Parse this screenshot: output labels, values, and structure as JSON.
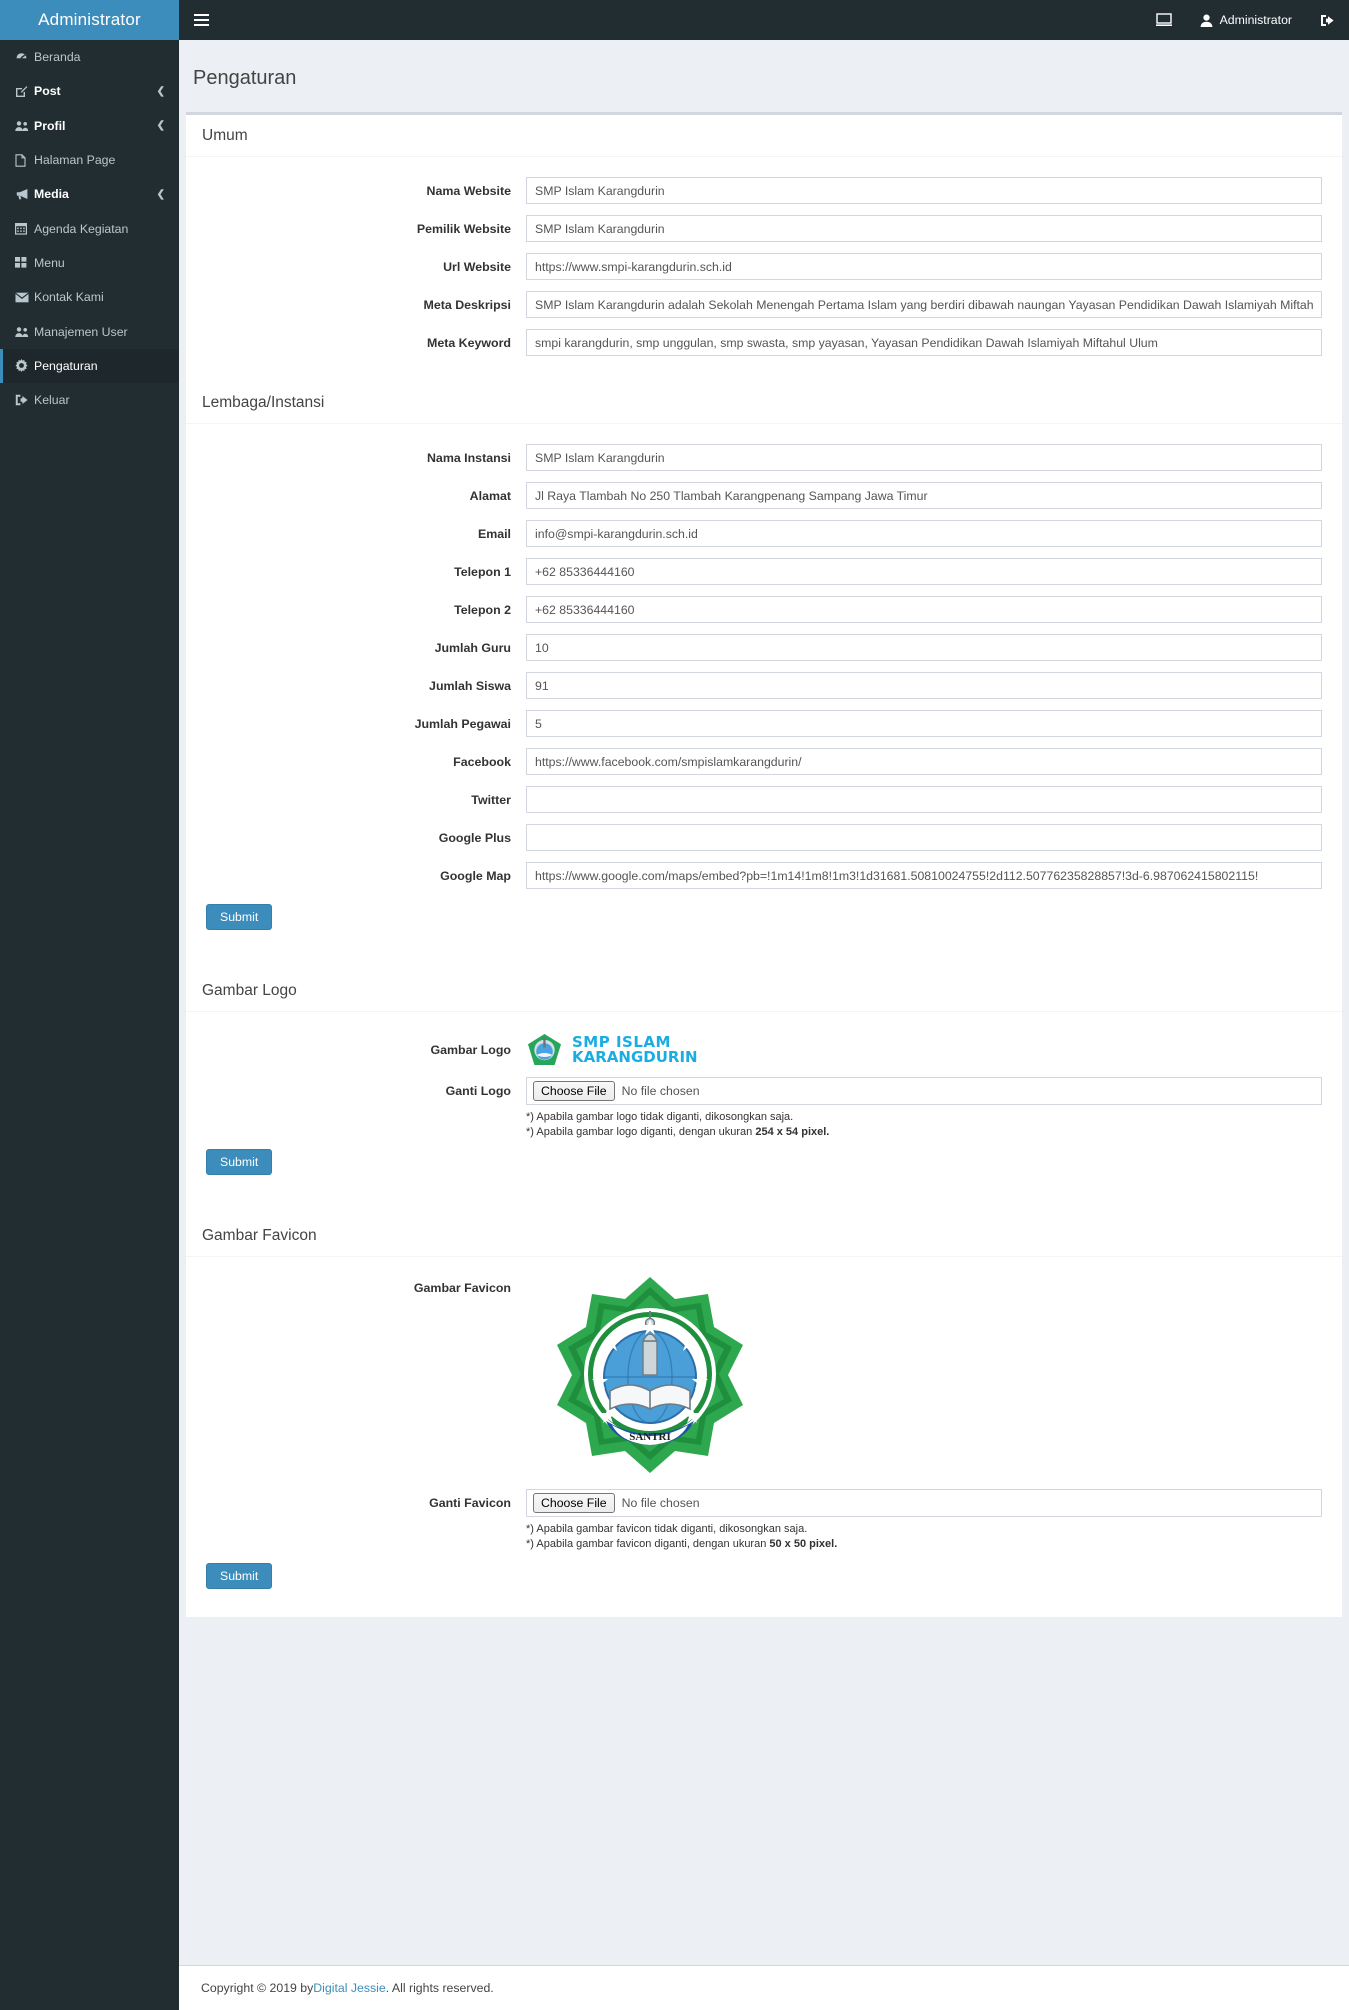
{
  "brand": {
    "title": "Administrator"
  },
  "topbar": {
    "hamburger_icon": "hamburger-icon",
    "screen_icon": "monitor-icon",
    "user_label": "Administrator",
    "logout_icon": "sign-out-icon"
  },
  "sidebar": {
    "items": [
      {
        "label": "Beranda",
        "icon": "dashboard-icon",
        "arrow": false,
        "strong": false,
        "active": false
      },
      {
        "label": "Post",
        "icon": "edit-icon",
        "arrow": true,
        "strong": true,
        "active": false
      },
      {
        "label": "Profil",
        "icon": "users-icon",
        "arrow": true,
        "strong": true,
        "active": false
      },
      {
        "label": "Halaman Page",
        "icon": "file-icon",
        "arrow": false,
        "strong": false,
        "active": false
      },
      {
        "label": "Media",
        "icon": "bullhorn-icon",
        "arrow": true,
        "strong": true,
        "active": false
      },
      {
        "label": "Agenda Kegiatan",
        "icon": "calendar-icon",
        "arrow": false,
        "strong": false,
        "active": false
      },
      {
        "label": "Menu",
        "icon": "grid-icon",
        "arrow": false,
        "strong": false,
        "active": false
      },
      {
        "label": "Kontak Kami",
        "icon": "envelope-icon",
        "arrow": false,
        "strong": false,
        "active": false
      },
      {
        "label": "Manajemen User",
        "icon": "users-icon",
        "arrow": false,
        "strong": false,
        "active": false
      },
      {
        "label": "Pengaturan",
        "icon": "gear-icon",
        "arrow": false,
        "strong": false,
        "active": true
      },
      {
        "label": "Keluar",
        "icon": "sign-out-icon",
        "arrow": false,
        "strong": false,
        "active": false
      }
    ]
  },
  "page": {
    "title": "Pengaturan"
  },
  "sections": {
    "umum": {
      "heading": "Umum",
      "fields": [
        {
          "label": "Nama Website",
          "value": "SMP Islam Karangdurin"
        },
        {
          "label": "Pemilik Website",
          "value": "SMP Islam Karangdurin"
        },
        {
          "label": "Url Website",
          "value": "https://www.smpi-karangdurin.sch.id"
        },
        {
          "label": "Meta Deskripsi",
          "value": "SMP Islam Karangdurin adalah Sekolah Menengah Pertama Islam yang berdiri dibawah naungan Yayasan Pendidikan Dawah Islamiyah Miftahul Ulum"
        },
        {
          "label": "Meta Keyword",
          "value": "smpi karangdurin, smp unggulan, smp swasta, smp yayasan, Yayasan Pendidikan Dawah Islamiyah Miftahul Ulum"
        }
      ]
    },
    "lembaga": {
      "heading": "Lembaga/Instansi",
      "fields": [
        {
          "label": "Nama Instansi",
          "value": "SMP Islam Karangdurin"
        },
        {
          "label": "Alamat",
          "value": "Jl Raya Tlambah No 250 Tlambah Karangpenang Sampang Jawa Timur"
        },
        {
          "label": "Email",
          "value": "info@smpi-karangdurin.sch.id"
        },
        {
          "label": "Telepon 1",
          "value": "+62 85336444160"
        },
        {
          "label": "Telepon 2",
          "value": "+62 85336444160"
        },
        {
          "label": "Jumlah Guru",
          "value": "10"
        },
        {
          "label": "Jumlah Siswa",
          "value": "91"
        },
        {
          "label": "Jumlah Pegawai",
          "value": "5"
        },
        {
          "label": "Facebook",
          "value": "https://www.facebook.com/smpislamkarangdurin/"
        },
        {
          "label": "Twitter",
          "value": ""
        },
        {
          "label": "Google Plus",
          "value": ""
        },
        {
          "label": "Google Map",
          "value": "https://www.google.com/maps/embed?pb=!1m14!1m8!1m3!1d31681.50810024755!2d112.50776235828857!3d-6.987062415802115!"
        }
      ],
      "submit_label": "Submit"
    },
    "logo": {
      "heading": "Gambar Logo",
      "image_label": "Gambar Logo",
      "logo_text_line1": "SMP  ISLAM",
      "logo_text_line2": "KARANGDURIN",
      "change_label": "Ganti Logo",
      "file_button": "Choose File",
      "file_status": "No file chosen",
      "hint1_a": "*) Apabila gambar logo tidak diganti, dikosongkan saja.",
      "hint2_a": "*) Apabila gambar logo diganti, dengan ukuran ",
      "hint2_b": "254 x 54 pixel.",
      "submit_label": "Submit"
    },
    "favicon": {
      "heading": "Gambar Favicon",
      "image_label": "Gambar Favicon",
      "change_label": "Ganti Favicon",
      "file_button": "Choose File",
      "file_status": "No file chosen",
      "hint1_a": "*) Apabila gambar favicon tidak diganti, dikosongkan saja.",
      "hint2_a": "*) Apabila gambar favicon diganti, dengan ukuran ",
      "hint2_b": "50 x 50 pixel.",
      "submit_label": "Submit",
      "emblem_text": "SANTRI"
    }
  },
  "footer": {
    "copy_prefix": "Copyright © 2019 by ",
    "link": "Digital Jessie",
    "copy_suffix": ". All rights reserved."
  },
  "colors": {
    "brand_blue": "#3c8dbc",
    "sidebar_dark": "#222d32",
    "page_bg": "#ecf0f5",
    "logo_cyan": "#1aade4",
    "logo_green": "#26a65b"
  }
}
